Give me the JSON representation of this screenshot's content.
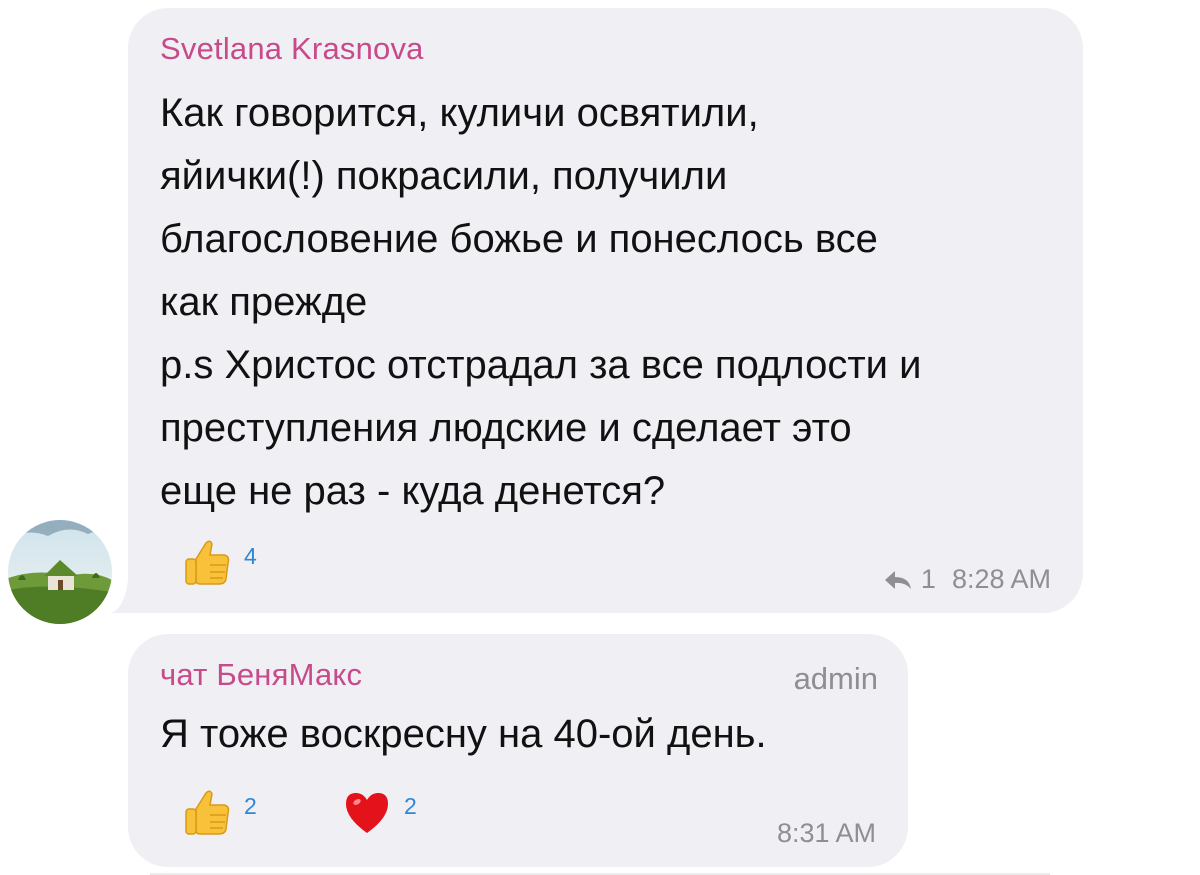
{
  "messages": [
    {
      "sender": "Svetlana Krasnova",
      "lines": [
        "Как говорится, куличи освятили,",
        "яйички(!) покрасили, получили",
        "благословение божье и понеслось все",
        "как прежде",
        "p.s Христос отстрадал за все подлости и",
        "преступления людские и сделает это",
        "еще не раз - куда денется?"
      ],
      "reactions": [
        {
          "icon": "thumbs-up-icon",
          "count": "4"
        }
      ],
      "reply_count": "1",
      "time": "8:28 AM"
    },
    {
      "sender": "чат БеняМакс",
      "role": "admin",
      "text": "Я тоже воскресну на 40-ой день.",
      "reactions": [
        {
          "icon": "thumbs-up-icon",
          "count": "2"
        },
        {
          "icon": "heart-icon",
          "count": "2"
        }
      ],
      "time": "8:31 AM"
    }
  ],
  "colors": {
    "bubble": "#f0eff4",
    "sender": "#c74b8a",
    "reaction_count": "#2e87d6",
    "meta": "#8e8e93"
  }
}
